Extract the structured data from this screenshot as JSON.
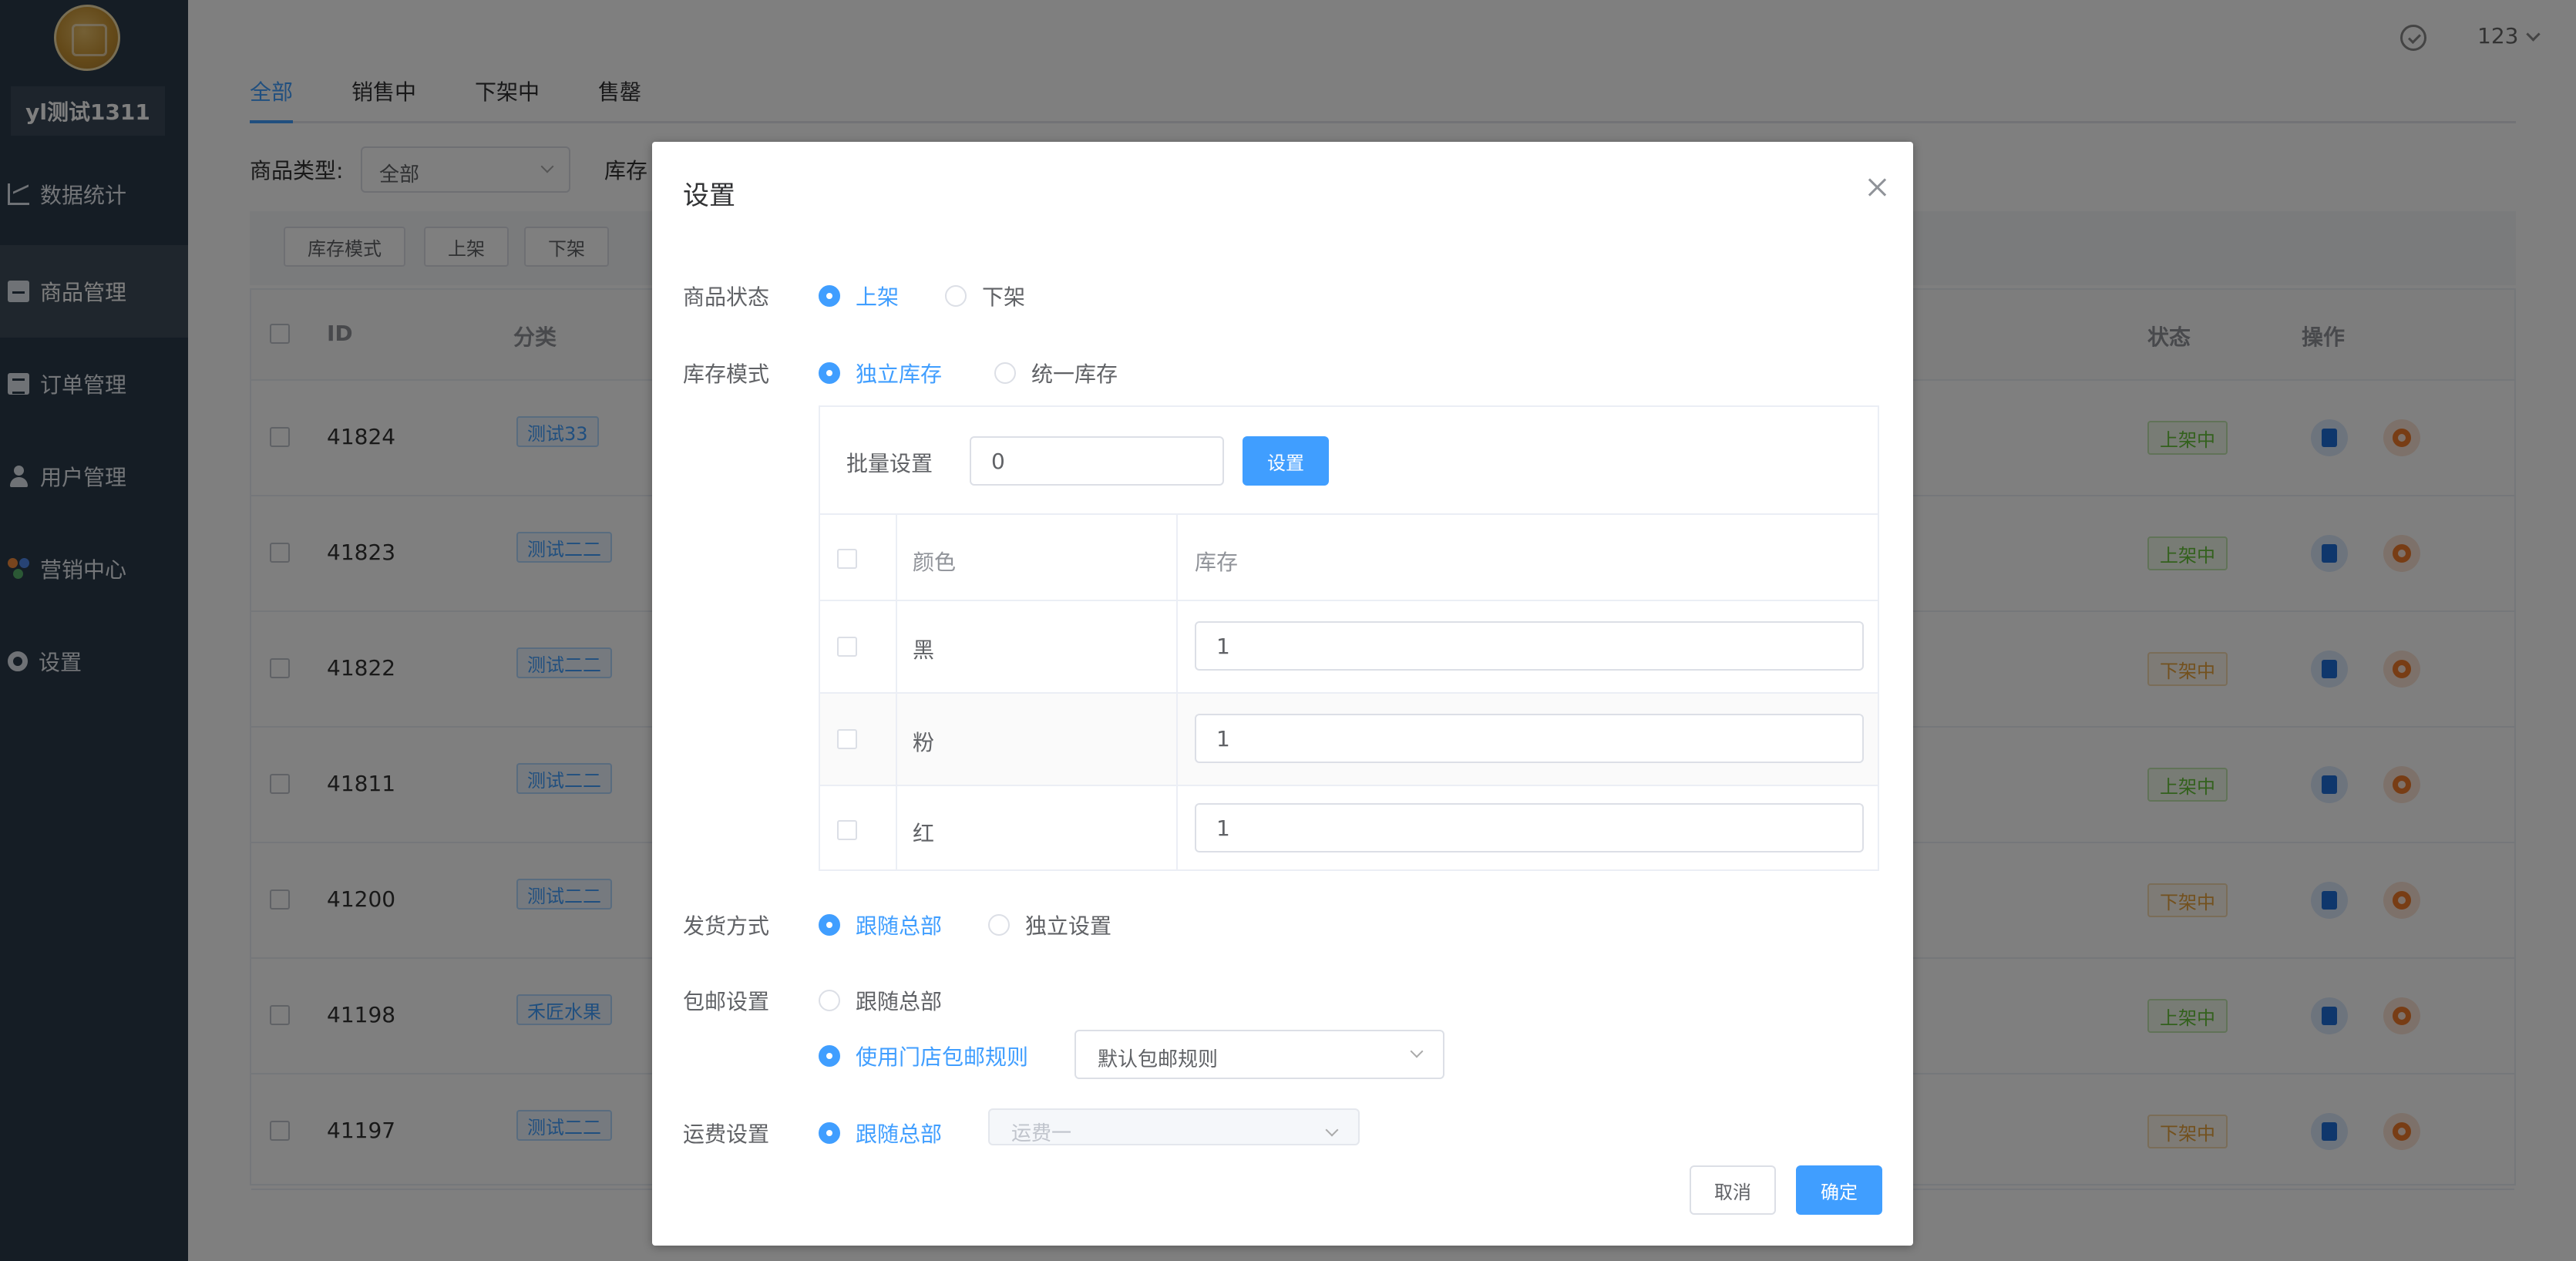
{
  "sidebar": {
    "username": "yl测试1311",
    "items": [
      {
        "label": "数据统计",
        "icon": "chart-icon"
      },
      {
        "label": "商品管理",
        "icon": "box-icon",
        "active": true
      },
      {
        "label": "订单管理",
        "icon": "list-icon"
      },
      {
        "label": "用户管理",
        "icon": "user-icon"
      },
      {
        "label": "营销中心",
        "icon": "marketing-icon"
      },
      {
        "label": "设置",
        "icon": "gear-icon"
      }
    ]
  },
  "topbar": {
    "user": "123"
  },
  "tabs": [
    "全部",
    "销售中",
    "下架中",
    "售罄"
  ],
  "filter": {
    "type_label": "商品类型:",
    "type_value": "全部",
    "stock_label": "库存"
  },
  "toolbar": {
    "stock_mode": "库存模式",
    "on_shelf": "上架",
    "off_shelf": "下架"
  },
  "table": {
    "headers": {
      "id": "ID",
      "category": "分类",
      "status": "状态",
      "actions": "操作"
    },
    "rows": [
      {
        "id": "41824",
        "category": "测试33",
        "status": "上架中"
      },
      {
        "id": "41823",
        "category": "测试二二",
        "status": "上架中"
      },
      {
        "id": "41822",
        "category": "测试二二",
        "status": "下架中"
      },
      {
        "id": "41811",
        "category": "测试二二",
        "status": "上架中"
      },
      {
        "id": "41200",
        "category": "测试二二",
        "status": "下架中"
      },
      {
        "id": "41198",
        "category": "禾匠水果",
        "status": "上架中"
      },
      {
        "id": "41197",
        "category": "测试二二",
        "status": "下架中"
      }
    ]
  },
  "dialog": {
    "title": "设置",
    "product_status": {
      "label": "商品状态",
      "options": [
        "上架",
        "下架"
      ],
      "selected": "上架"
    },
    "stock_mode": {
      "label": "库存模式",
      "options": [
        "独立库存",
        "统一库存"
      ],
      "selected": "独立库存"
    },
    "batch": {
      "label": "批量设置",
      "value": "0",
      "button": "设置"
    },
    "stock_table": {
      "headers": {
        "color": "颜色",
        "stock": "库存"
      },
      "rows": [
        {
          "color": "黑",
          "stock": "1"
        },
        {
          "color": "粉",
          "stock": "1"
        },
        {
          "color": "红",
          "stock": "1"
        }
      ]
    },
    "shipping": {
      "label": "发货方式",
      "options": [
        "跟随总部",
        "独立设置"
      ],
      "selected": "跟随总部"
    },
    "free_shipping": {
      "label": "包邮设置",
      "options": [
        "跟随总部",
        "使用门店包邮规则"
      ],
      "selected": "使用门店包邮规则",
      "rule_value": "默认包邮规则"
    },
    "freight": {
      "label": "运费设置",
      "option": "跟随总部",
      "placeholder": "运费一"
    },
    "cancel": "取消",
    "confirm": "确定"
  },
  "colors": {
    "accent": "#409eff",
    "on_shelf": "#67c23a",
    "off_shelf": "#e6a23c",
    "sidebar_bg": "#2b3a4a"
  }
}
